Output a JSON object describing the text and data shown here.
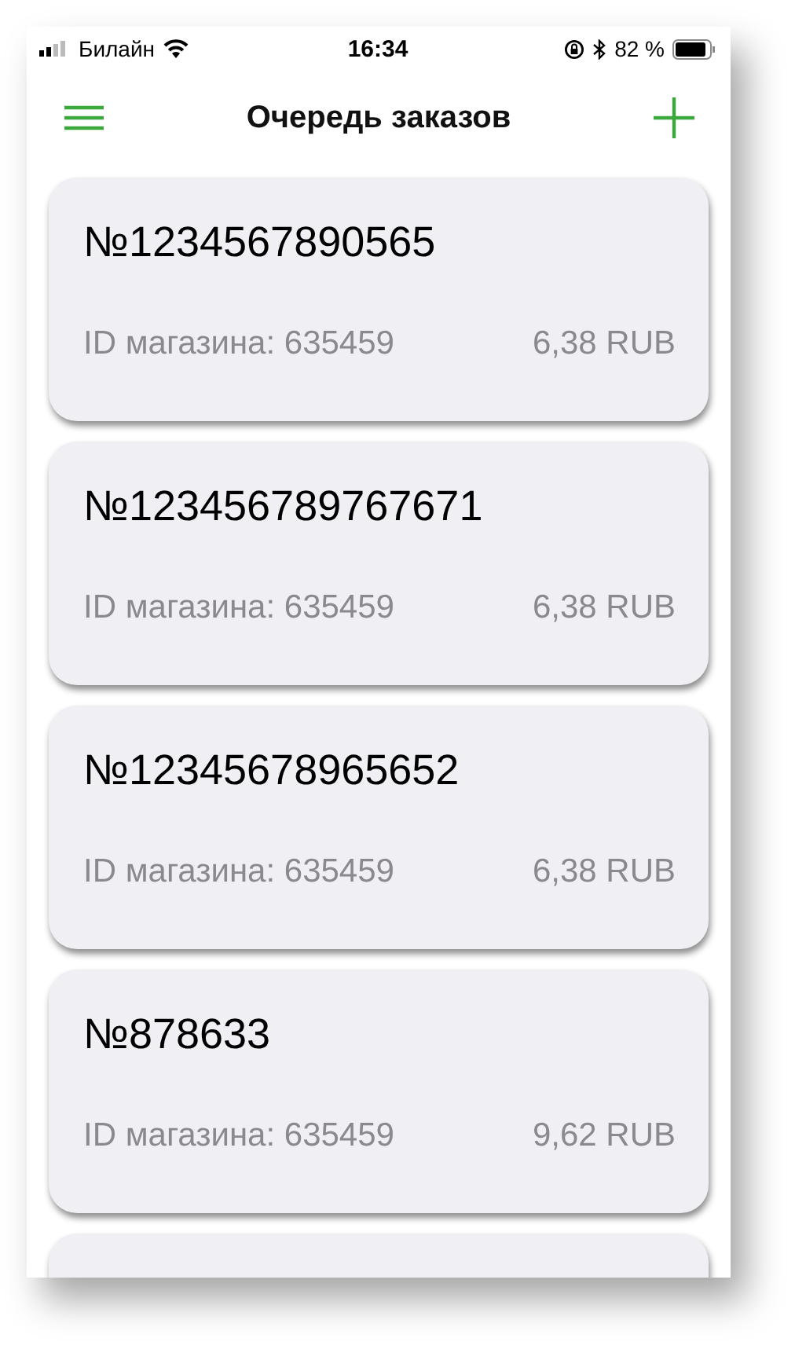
{
  "status_bar": {
    "carrier": "Билайн",
    "time": "16:34",
    "battery": "82 %"
  },
  "header": {
    "title": "Очередь заказов"
  },
  "orders": [
    {
      "number": "№1234567890565",
      "store": "ID магазина: 635459",
      "amount": "6,38 RUB"
    },
    {
      "number": "№123456789767671",
      "store": "ID магазина: 635459",
      "amount": "6,38 RUB"
    },
    {
      "number": "№12345678965652",
      "store": "ID магазина: 635459",
      "amount": "6,38 RUB"
    },
    {
      "number": "№878633",
      "store": "ID магазина: 635459",
      "amount": "9,62 RUB"
    }
  ]
}
